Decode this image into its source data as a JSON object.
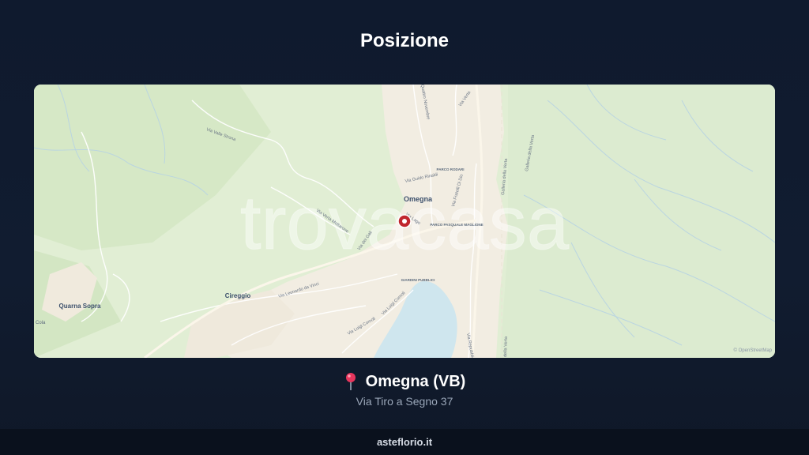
{
  "page": {
    "title": "Posizione"
  },
  "map": {
    "watermark": "trovacasa",
    "attribution": "© OpenStreetMap",
    "marker_color": "#c0262d",
    "places": {
      "town": "Omegna",
      "village": "Cireggio",
      "hamlet": "Quarna Sopra",
      "edge_fragment": "Cola"
    },
    "parks": {
      "rodari": "PARCO RODARI",
      "pasquale": "PARCO PASQUALE\nMAGLIONE",
      "giardini": "GIARDINI PUBBLICI"
    },
    "streets": {
      "quattro_novembre": "Quattro Novembre",
      "verta_top": "Via Verta",
      "valle_strona": "Via Valle Strona",
      "guido_rinaldi": "Via Guido Rinaldi",
      "novembre_short": "Via IV Nov",
      "fratelli": "Via Fratelli Di Dio",
      "lago": "Via Lago",
      "leonardo": "Via Leonardo da Vinci",
      "luigi_comoli_1": "Via Luigi Comoli",
      "luigi_comoli_2": "Via Luigi Comoli",
      "zucchini": "Via dei Gali",
      "verta_gallery_1": "Galleria della Verta",
      "verta_gallery_2": "Galleria della Verta",
      "verta_gallery_3": "della Verta",
      "repubblica": "Via Repubblica",
      "strona_diag": "Via Verta Mottarone"
    }
  },
  "location": {
    "name": "Omegna (VB)",
    "address": "Via Tiro a Segno 37"
  },
  "footer": {
    "site": "asteflorio.it"
  }
}
